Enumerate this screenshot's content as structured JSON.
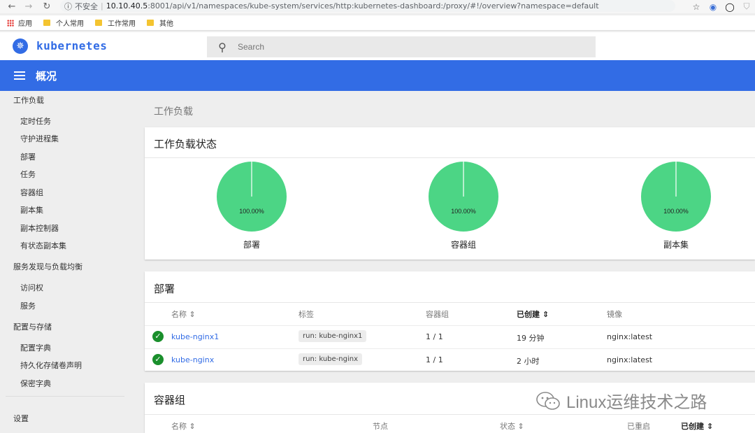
{
  "browser": {
    "insecure_label": "不安全",
    "url_host": "10.10.40.5",
    "url_rest": ":8001/api/v1/namespaces/kube-system/services/http:kubernetes-dashboard:/proxy/#!/overview?namespace=default",
    "bookmarks": [
      "应用",
      "个人常用",
      "工作常用",
      "其他"
    ]
  },
  "header": {
    "brand": "kubernetes",
    "search_placeholder": "Search"
  },
  "toolbar": {
    "title": "概况"
  },
  "sidebar": {
    "section_workloads": "工作负载",
    "workload_items": [
      "定时任务",
      "守护进程集",
      "部署",
      "任务",
      "容器组",
      "副本集",
      "副本控制器",
      "有状态副本集"
    ],
    "section_discovery": "服务发现与负载均衡",
    "discovery_items": [
      "访问权",
      "服务"
    ],
    "section_config": "配置与存储",
    "config_items": [
      "配置字典",
      "持久化存储卷声明",
      "保密字典"
    ],
    "settings": "设置"
  },
  "main": {
    "breadcrumb": "工作负载",
    "status_card": {
      "title": "工作负载状态",
      "pies": [
        {
          "label": "部署",
          "percent_text": "100.00%",
          "fraction": 1.0
        },
        {
          "label": "容器组",
          "percent_text": "100.00%",
          "fraction": 1.0
        },
        {
          "label": "副本集",
          "percent_text": "100.00%",
          "fraction": 1.0
        }
      ]
    },
    "deployments": {
      "title": "部署",
      "columns": [
        "名称",
        "标签",
        "容器组",
        "已创建",
        "镜像"
      ],
      "rows": [
        {
          "name": "kube-nginx1",
          "label": "run: kube-nginx1",
          "pods": "1 / 1",
          "created": "19 分钟",
          "image": "nginx:latest"
        },
        {
          "name": "kube-nginx",
          "label": "run: kube-nginx",
          "pods": "1 / 1",
          "created": "2 小时",
          "image": "nginx:latest"
        }
      ]
    },
    "pods": {
      "title": "容器组",
      "columns": [
        "名称",
        "节点",
        "状态",
        "已重启",
        "已创建"
      ]
    }
  },
  "colors": {
    "brand": "#326ce5",
    "pie_ok": "#4cd585",
    "status_ok": "#1a8f2c"
  },
  "watermark": "Linux运维技术之路"
}
